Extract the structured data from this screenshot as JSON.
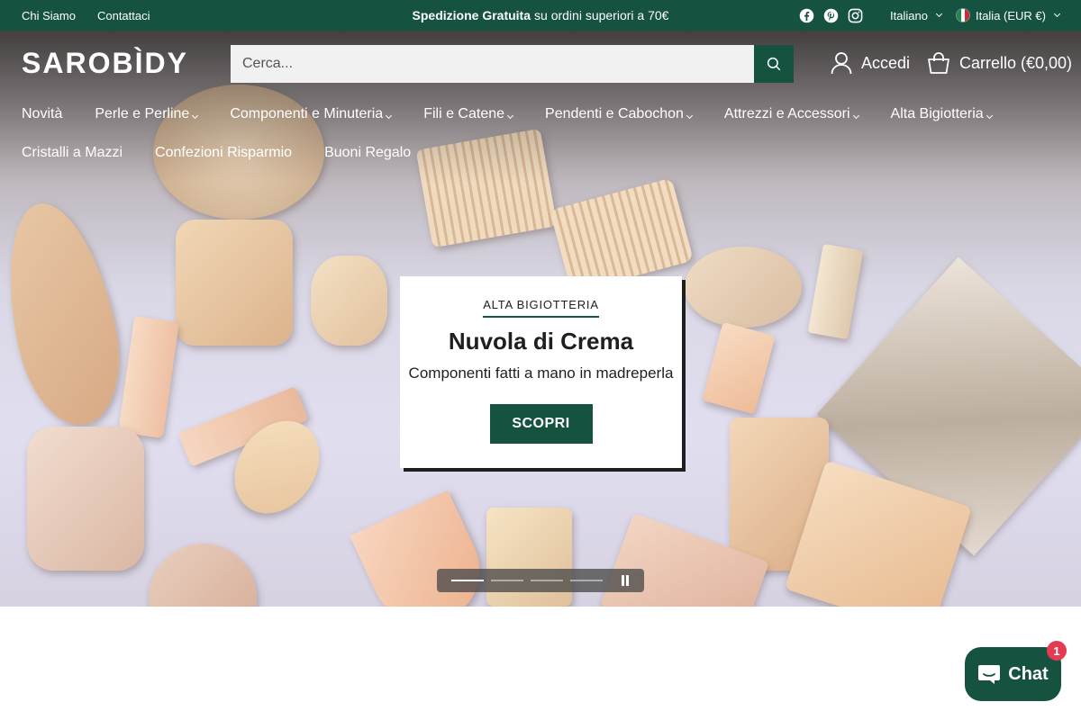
{
  "topbar": {
    "links": [
      "Chi Siamo",
      "Contattaci"
    ],
    "promo_bold": "Spedizione Gratuita",
    "promo_rest": "su ordini superiori a 70€",
    "social": [
      "facebook-icon",
      "pinterest-icon",
      "instagram-icon"
    ],
    "language": "Italiano",
    "currency": "Italia (EUR €)"
  },
  "header": {
    "logo": "SAROBÌDY",
    "search_placeholder": "Cerca...",
    "account_label": "Accedi",
    "cart_label": "Carrello (€0,00)"
  },
  "nav": {
    "row1": [
      {
        "label": "Novità",
        "dropdown": false
      },
      {
        "label": "Perle e Perline",
        "dropdown": true
      },
      {
        "label": "Componenti e Minuteria",
        "dropdown": true
      },
      {
        "label": "Fili e Catene",
        "dropdown": true
      },
      {
        "label": "Pendenti e Cabochon",
        "dropdown": true
      },
      {
        "label": "Attrezzi e Accessori",
        "dropdown": true
      },
      {
        "label": "Alta Bigiotteria",
        "dropdown": true
      }
    ],
    "row2": [
      {
        "label": "Cristalli a Mazzi"
      },
      {
        "label": "Confezioni Risparmio"
      },
      {
        "label": "Buoni Regalo"
      }
    ]
  },
  "hero": {
    "kicker": "ALTA BIGIOTTERIA",
    "title": "Nuvola di Crema",
    "subtitle": "Componenti fatti a mano in madreperla",
    "cta": "SCOPRI",
    "slides_total": 4,
    "slide_active": 1
  },
  "chat": {
    "label": "Chat",
    "badge": "1"
  },
  "colors": {
    "brand": "#15523f",
    "badge": "#e33b52"
  }
}
